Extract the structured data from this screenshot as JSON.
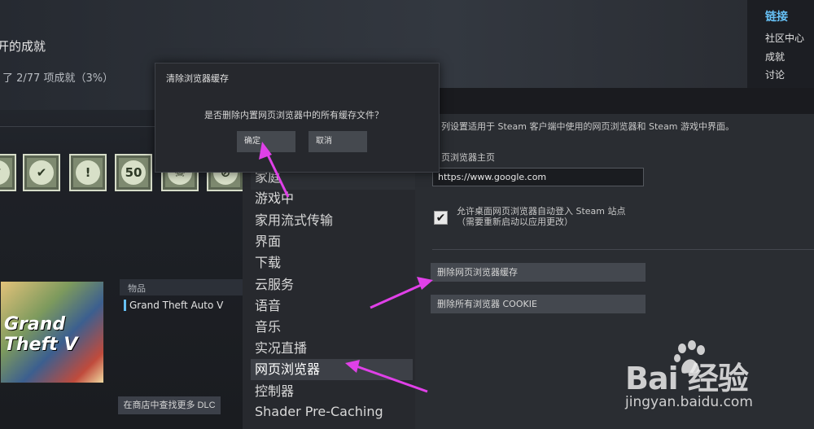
{
  "background": {
    "achievements_title": "开的成就",
    "achievements_progress": "了 2/77 项成就（3%）",
    "achievement_icons": [
      "check-shield-icon",
      "checkmark-icon",
      "exclamation-icon",
      "fifty-icon",
      "skull-icon",
      "no-entry-icon"
    ],
    "fifty_label": "50",
    "sidebar": {
      "title": "链接",
      "links": [
        "社区中心",
        "成就",
        "讨论"
      ]
    },
    "dlc": {
      "art_text": "Grand Theft Auto V",
      "items_header": "物品",
      "item_name": "Grand Theft Auto V",
      "find_more_button": "在商店中查找更多 DLC"
    }
  },
  "settings": {
    "nav_items": [
      "家庭",
      "游戏中",
      "家用流式传输",
      "界面",
      "下载",
      "云服务",
      "语音",
      "音乐",
      "实况直播",
      "网页浏览器",
      "控制器",
      "Shader Pre-Caching"
    ],
    "active_nav": "网页浏览器",
    "content": {
      "description": "列设置适用于 Steam 客户端中使用的网页浏览器和 Steam 游戏中界面。",
      "homepage_label": "页浏览器主页",
      "homepage_value": "https://www.google.com",
      "autologin_label_line1": "允许桌面网页浏览器自动登入 Steam 站点",
      "autologin_label_line2": "（需要重新启动以应用更改）",
      "autologin_checked": true,
      "clear_cache_button": "删除网页浏览器缓存",
      "clear_cookies_button": "删除所有浏览器 COOKIE"
    }
  },
  "dialog": {
    "title": "清除浏览器缓存",
    "message": "是否删除内置网页浏览器中的所有缓存文件？",
    "ok_button": "确定",
    "cancel_button": "取消"
  },
  "watermark": {
    "logo_text": "Bai  经验",
    "url": "jingyan.baidu.com"
  },
  "colors": {
    "annotation_arrow": "#e040e8",
    "link_blue": "#66c0f4"
  }
}
